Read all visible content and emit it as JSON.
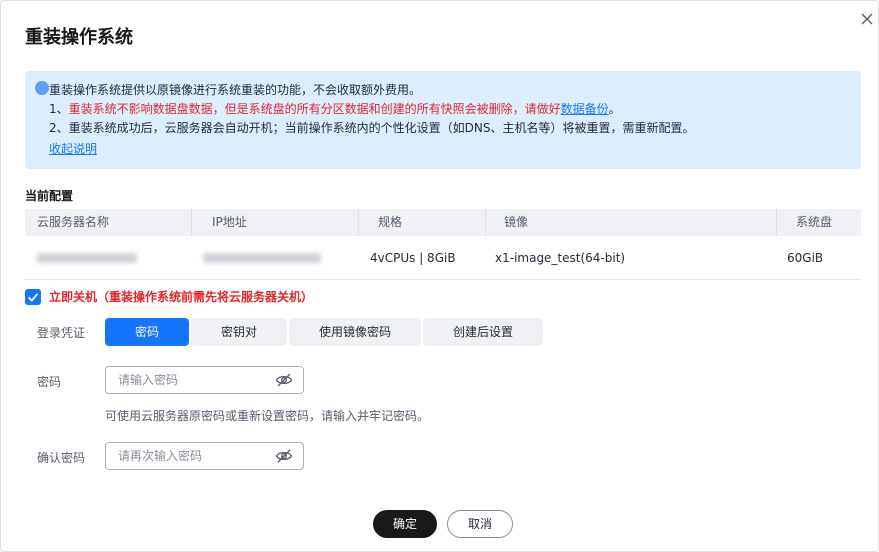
{
  "dialog": {
    "title": "重装操作系统"
  },
  "notice": {
    "line0": "重装操作系统提供以原镜像进行系统重装的功能，不会收取额外费用。",
    "line1_prefix": "1、",
    "line1_red": "重装系统不影响数据盘数据，但是系统盘的所有分区数据和创建的所有快照会被删除，请做好",
    "line1_link": "数据备份",
    "line1_suffix": "。",
    "line2": "2、重装系统成功后，云服务器会自动开机；当前操作系统内的个性化设置（如DNS、主机名等）将被重置，需重新配置。",
    "collapse_link": "收起说明"
  },
  "current_config": {
    "label": "当前配置",
    "headers": [
      "云服务器名称",
      "IP地址",
      "规格",
      "镜像",
      "系统盘"
    ],
    "row": {
      "spec": "4vCPUs | 8GiB",
      "image": "x1-image_test(64-bit)",
      "disk": "60GiB"
    }
  },
  "shutdown": {
    "label": "立即关机（重装操作系统前需先将云服务器关机）",
    "checked": true
  },
  "login_credential": {
    "label": "登录凭证",
    "options": [
      "密码",
      "密钥对",
      "使用镜像密码",
      "创建后设置"
    ],
    "selected": "密码"
  },
  "password": {
    "label": "密码",
    "placeholder": "请输入密码",
    "hint": "可使用云服务器原密码或重新设置密码，请输入并牢记密码。"
  },
  "confirm_password": {
    "label": "确认密码",
    "placeholder": "请再次输入密码"
  },
  "footer": {
    "ok_label": "确定",
    "cancel_label": "取消"
  },
  "colors": {
    "accent": "#1476ff",
    "warning": "#e0282e",
    "notice_bg": "#dceefe",
    "primary_button": "#191919"
  },
  "icons": {
    "close": "close-icon",
    "info": "info-icon",
    "check": "check-icon",
    "eye_off": "eye-off-icon"
  }
}
